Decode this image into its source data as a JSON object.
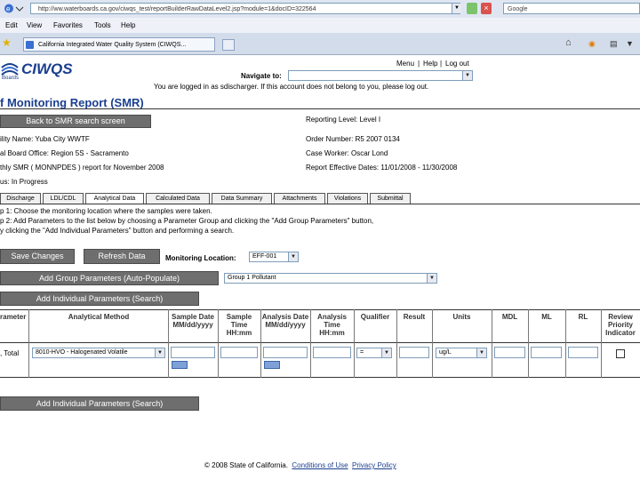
{
  "browser": {
    "url": "http://ww.waterboards.ca.gov/ciwqs_test/reportBuilderRawDataLevel2.jsp?module=1&docID=322564",
    "search_placeholder": "Google",
    "menu": [
      "Edit",
      "View",
      "Favorites",
      "Tools",
      "Help"
    ],
    "tab_title": "California Integrated Water Quality System (CIWQS..."
  },
  "header": {
    "logo_text": "CIWQS",
    "board_text": "Boards",
    "links": [
      "Menu",
      "Help",
      "Log out"
    ],
    "navigate_label": "Navigate to:",
    "login_message": "You are logged in as sdischarger. If this account does not belong to you, please log out."
  },
  "page_title": "f Monitoring Report (SMR)",
  "back_button": "Back to SMR search screen",
  "info_left": [
    "ility Name: Yuba City WWTF",
    "al Board Office: Region 5S - Sacramento",
    "thly SMR ( MONNPDES ) report for November 2008",
    "us: In Progress"
  ],
  "info_right": [
    "Reporting Level: Level I",
    "Order Number: R5 2007 0134",
    "Case Worker: Oscar Lond",
    "Report Effective Dates: 11/01/2008 - 11/30/2008"
  ],
  "tabs": [
    "Discharge",
    "LDL/CDL",
    "Analytical Data",
    "Calculated Data",
    "Data Summary",
    "Attachments",
    "Violations",
    "Submittal"
  ],
  "instructions": [
    "p 1: Choose the monitoring location where the samples were taken.",
    "p 2: Add Parameters to the list below by choosing a Parameter Group and clicking the \"Add Group Parameters\" button,",
    "y clicking the \"Add Individual Parameters\" button and performing a search."
  ],
  "buttons": {
    "save": "Save Changes",
    "refresh": "Refresh Data",
    "add_group": "Add Group Parameters (Auto-Populate)",
    "add_individual": "Add Individual Parameters (Search)"
  },
  "monitoring_location": {
    "label": "Monitoring Location:",
    "value": "EFF-001"
  },
  "parameter_group": {
    "value": "Group 1 Pollutant"
  },
  "table": {
    "headers": {
      "parameter": "rameter",
      "method": "Analytical Method",
      "sample_date": "Sample Date MM/dd/yyyy",
      "sample_time": "Sample Time HH:mm",
      "analysis_date": "Analysis Date MM/dd/yyyy",
      "analysis_time": "Analysis Time HH:mm",
      "qualifier": "Qualifier",
      "result": "Result",
      "units": "Units",
      "mdl": "MDL",
      "ml": "ML",
      "rl": "RL",
      "review": "Review Priority Indicator"
    },
    "row": {
      "parameter": ", Total",
      "method": "8010-HVO - Halogenated Volatile",
      "qualifier": "=",
      "units": "ug/L"
    }
  },
  "footer": {
    "copyright": "© 2008 State of California.",
    "conditions": "Conditions of Use",
    "privacy": "Privacy Policy"
  }
}
